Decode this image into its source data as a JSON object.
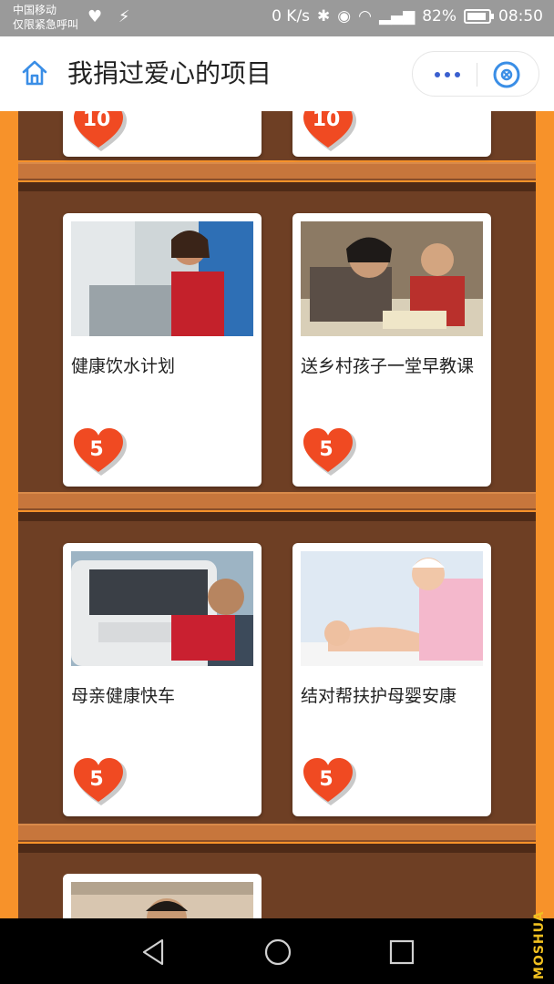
{
  "status_bar": {
    "carrier_line1": "中国移动",
    "carrier_line2": "仅限紧急呼叫",
    "left_icons": "♥ ⚡",
    "network_speed": "0 K/s",
    "battery_percent": "82%",
    "time": "08:50"
  },
  "header": {
    "title": "我捐过爱心的项目"
  },
  "top_partial_cards": [
    {
      "count": "10"
    },
    {
      "count": "10"
    }
  ],
  "projects": [
    {
      "name": "健康饮水计划",
      "count": "5",
      "image": "girl-at-water-tap-photo"
    },
    {
      "name": "送乡村孩子一堂早教课",
      "count": "5",
      "image": "teacher-and-child-reading-photo"
    },
    {
      "name": "母亲健康快车",
      "count": "5",
      "image": "mother-health-van-photo"
    },
    {
      "name": "结对帮扶护母婴安康",
      "count": "5",
      "image": "nurse-with-baby-photo"
    }
  ],
  "watermark": "MOSHUA",
  "colors": {
    "page_bg": "#f7922a",
    "shelf_back": "#6e3f24",
    "shelf_board": "#c7763c",
    "heart_red": "#f04a22",
    "accent_blue": "#3a8ee6"
  }
}
